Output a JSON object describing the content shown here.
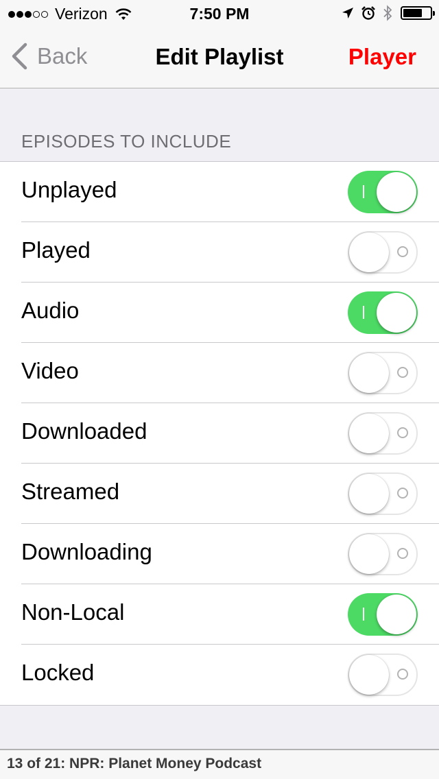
{
  "status_bar": {
    "signal_bars_filled": 3,
    "signal_bars_total": 5,
    "carrier": "Verizon",
    "time": "7:50 PM",
    "icons": [
      "wifi-icon",
      "location-arrow-icon",
      "alarm-icon",
      "bluetooth-icon",
      "battery-icon"
    ],
    "battery_level": 0.7
  },
  "nav": {
    "back_label": "Back",
    "title": "Edit Playlist",
    "right_label": "Player"
  },
  "section": {
    "header": "EPISODES TO INCLUDE"
  },
  "rows": [
    {
      "label": "Unplayed",
      "on": true
    },
    {
      "label": "Played",
      "on": false
    },
    {
      "label": "Audio",
      "on": true
    },
    {
      "label": "Video",
      "on": false
    },
    {
      "label": "Downloaded",
      "on": false
    },
    {
      "label": "Streamed",
      "on": false
    },
    {
      "label": "Downloading",
      "on": false
    },
    {
      "label": "Non-Local",
      "on": true
    },
    {
      "label": "Locked",
      "on": false
    }
  ],
  "footer": {
    "now_playing": "13 of 21: NPR: Planet Money Podcast"
  },
  "colors": {
    "accent": "#ff0000",
    "toggle_on": "#4cd964",
    "back_gray": "#8e8e93"
  }
}
